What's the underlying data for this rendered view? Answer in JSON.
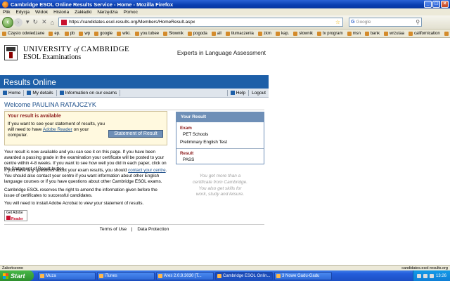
{
  "window": {
    "title": "Cambridge ESOL Online Results Service - Home - Mozilla Firefox",
    "minimize": "_",
    "maximize": "□",
    "close": "×"
  },
  "menu": [
    "Plik",
    "Edycja",
    "Widok",
    "Historia",
    "Zakładki",
    "Narzędzia",
    "Pomoc"
  ],
  "nav": {
    "url": "https://candidates.esol-results.org/Members/HomeResult.aspx",
    "search_placeholder": "Google"
  },
  "bookmarks": [
    "Często odwiedzane",
    "ep.",
    "pb",
    "wp",
    "google",
    "wiki.",
    "you.tubee",
    "Słownik",
    "pogoda",
    "all",
    "tłumaczenia",
    "zkm",
    "kap.",
    "słownik",
    "tv program",
    "msn",
    "bank",
    "wrzutaa",
    "californication",
    "trojmiasto"
  ],
  "header": {
    "uni_line1_a": "UNIVERSITY",
    "uni_line1_of": "of",
    "uni_line1_b": "CAMBRIDGE",
    "uni_line2": "ESOL Examinations",
    "tagline": "Experts in Language Assessment"
  },
  "banner": "Results Online",
  "subnav": {
    "home": "Home",
    "details": "My details",
    "exams": "Information on our exams",
    "help": "Help",
    "logout": "Logout"
  },
  "welcome": "Welcome PAULINA RATAJCZYK",
  "avail": {
    "title": "Your result is available",
    "text_a": "If you want to see your statement of results, you will need to have ",
    "adobe_link": "Adobe Reader",
    "text_b": " on your computer.",
    "button": "Statement of Result"
  },
  "para1": "Your result is now available and you can see it on this page. If you have been awarded a passing grade in the examination your certificate will be posted to your centre within 4-8 weeks. If you want to see how well you did in each paper, click on the Statement of Result button.",
  "para2_a": "If you have any questions about your exam results, you should ",
  "para2_link": "contact your centre",
  "para2_b": ". You should also contact your centre if you want information about other English language courses or if you have questions about other Cambridge ESOL exams.",
  "para3": "Cambridge ESOL reserves the right to amend the information given before the issue of certificates to successful candidates.",
  "para4": "You will need to install Adobe Acrobat to view your statement of results.",
  "adobe_badge": {
    "line1": "Get Adobe",
    "line2": "Reader"
  },
  "result_panel": {
    "heading": "Your Result",
    "exam_label": "Exam",
    "exam_name": "PET Schools",
    "exam_full": "Preliminary English Test",
    "result_label": "Result",
    "result_value": "PASS"
  },
  "promo": [
    "You get more than a",
    "certificate from Cambridge.",
    "You also get skills for",
    "work, study and leisure."
  ],
  "footer": {
    "terms": "Terms of Use",
    "sep": "|",
    "privacy": "Data Protection"
  },
  "status": {
    "left": "Zakończono",
    "right": "candidates.esol-results.org"
  },
  "taskbar": {
    "start": "Start",
    "tasks": [
      "Muza",
      "iTunes",
      "Ares 2.0.9.3030 [T...",
      "Cambridge ESOL Onlin...",
      "3 Nowe Gadu-Gadu"
    ],
    "clock": "13:26"
  }
}
